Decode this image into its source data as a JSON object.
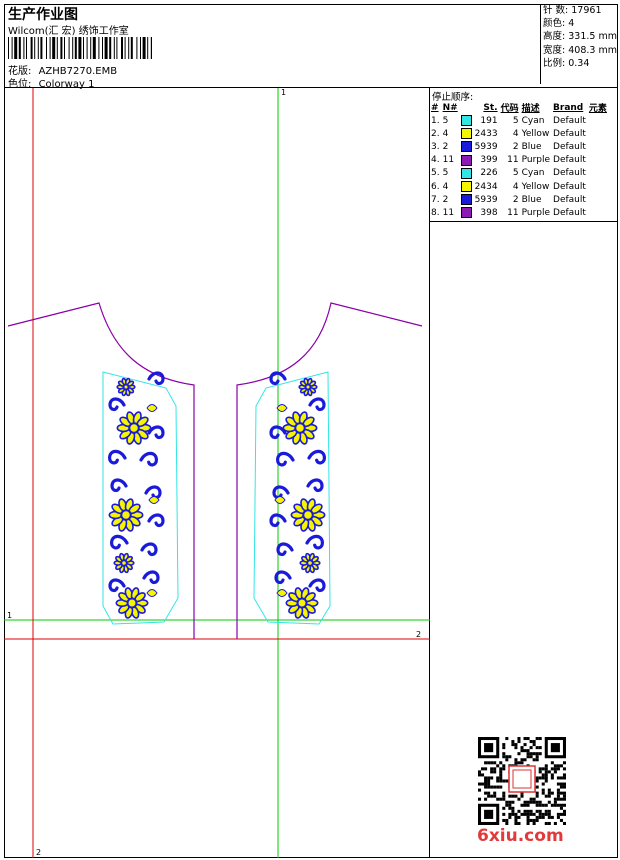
{
  "header": {
    "title": "生产作业图",
    "company": "Wilcom(汇 宏) 绣饰工作室",
    "pattern_label": "花版:",
    "pattern_value": "AZHB7270.EMB",
    "colorway_label": "色位:",
    "colorway_value": "Colorway 1"
  },
  "stats": [
    {
      "label": "针 数:",
      "value": "17961"
    },
    {
      "label": "颜色:",
      "value": "4"
    },
    {
      "label": "高度:",
      "value": "331.5 mm"
    },
    {
      "label": "宽度:",
      "value": "408.3 mm"
    },
    {
      "label": "比例:",
      "value": "0.34"
    }
  ],
  "sequence": {
    "title": "停止顺序:",
    "columns": [
      "#",
      "N#",
      "St.",
      "代码",
      "描述",
      "Brand",
      "元素"
    ],
    "rows": [
      {
        "idx": "1.",
        "needle": "5",
        "color": "#33e6e6",
        "stitches": "191",
        "code": "5",
        "desc": "Cyan",
        "brand": "Default"
      },
      {
        "idx": "2.",
        "needle": "4",
        "color": "#f5f500",
        "stitches": "2433",
        "code": "4",
        "desc": "Yellow",
        "brand": "Default"
      },
      {
        "idx": "3.",
        "needle": "2",
        "color": "#1a1adb",
        "stitches": "5939",
        "code": "2",
        "desc": "Blue",
        "brand": "Default"
      },
      {
        "idx": "4.",
        "needle": "11",
        "color": "#8c1ab3",
        "stitches": "399",
        "code": "11",
        "desc": "Purple",
        "brand": "Default"
      },
      {
        "idx": "5.",
        "needle": "5",
        "color": "#33e6e6",
        "stitches": "226",
        "code": "5",
        "desc": "Cyan",
        "brand": "Default"
      },
      {
        "idx": "6.",
        "needle": "4",
        "color": "#f5f500",
        "stitches": "2434",
        "code": "4",
        "desc": "Yellow",
        "brand": "Default"
      },
      {
        "idx": "7.",
        "needle": "2",
        "color": "#1a1adb",
        "stitches": "5939",
        "code": "2",
        "desc": "Blue",
        "brand": "Default"
      },
      {
        "idx": "8.",
        "needle": "11",
        "color": "#8c1ab3",
        "stitches": "398",
        "code": "11",
        "desc": "Purple",
        "brand": "Default"
      }
    ]
  },
  "guides": {
    "top_label": "1",
    "left_label": "1",
    "right_label": "2",
    "bottom_label": "2"
  },
  "colors": {
    "guide_green": "#00cc00",
    "guide_red": "#e00000",
    "outline_purple": "#8a00a8",
    "border_cyan": "#33e6e6",
    "thread_blue": "#1a1adb",
    "thread_yellow": "#f5f500"
  },
  "watermark": "6xiu.com",
  "qr_icon": "qr-code-icon"
}
